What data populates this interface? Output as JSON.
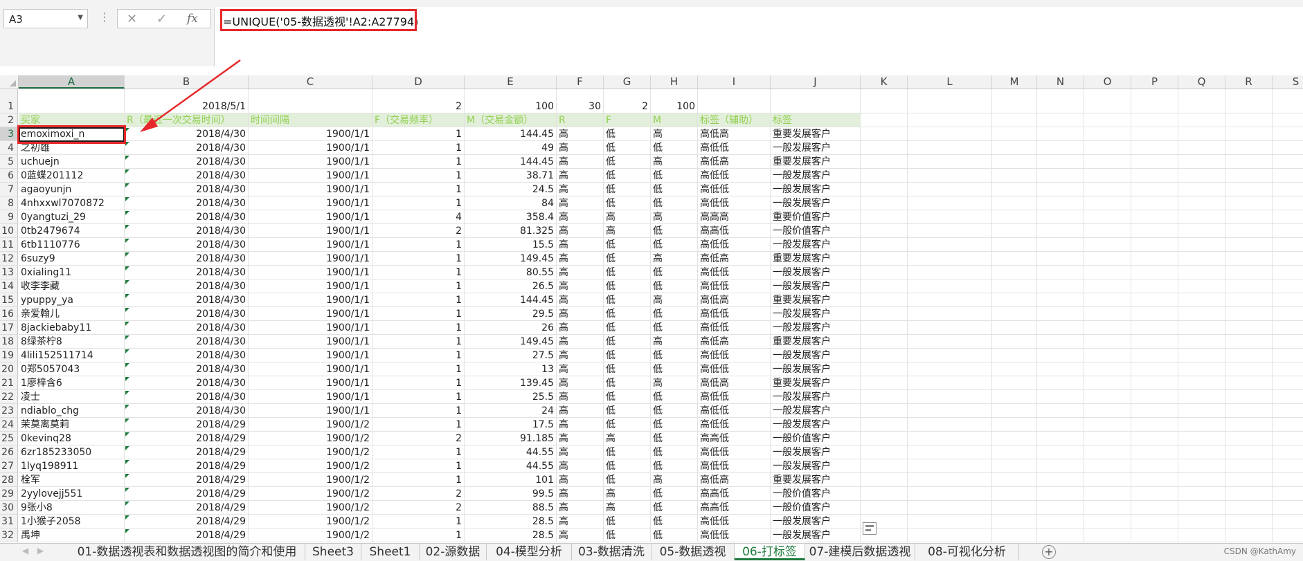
{
  "name_box": {
    "value": "A3",
    "dropdown_icon": "chevron-down-icon"
  },
  "formula_bar": {
    "cancel_icon": "x-icon",
    "confirm_icon": "check-icon",
    "fx_label": "fx",
    "formula": "=UNIQUE('05-数据透视'!A2:A27794)"
  },
  "columns": [
    "A",
    "B",
    "C",
    "D",
    "E",
    "F",
    "G",
    "H",
    "I",
    "J",
    "K",
    "L",
    "M",
    "N",
    "O",
    "P",
    "Q",
    "R",
    "S"
  ],
  "selected_column": "A",
  "selected_row": "3",
  "row1": [
    "",
    "2018/5/1",
    "",
    "2",
    "100",
    "30",
    "2",
    "100",
    "",
    ""
  ],
  "header_row": [
    "买家",
    "R（最近一次交易时间）",
    "时间间隔",
    "F（交易频率）",
    "M（交易金额）",
    "R",
    "F",
    "M",
    "标签（辅助）",
    "标签"
  ],
  "rows": [
    [
      "3",
      "emoximoxi_n",
      "2018/4/30",
      "1900/1/1",
      "1",
      "144.45",
      "高",
      "低",
      "高",
      "高低高",
      "重要发展客户"
    ],
    [
      "4",
      "之初雄",
      "2018/4/30",
      "1900/1/1",
      "1",
      "49",
      "高",
      "低",
      "低",
      "高低低",
      "一般发展客户"
    ],
    [
      "5",
      "uchuejn",
      "2018/4/30",
      "1900/1/1",
      "1",
      "144.45",
      "高",
      "低",
      "高",
      "高低高",
      "重要发展客户"
    ],
    [
      "6",
      "0蓝蝶201112",
      "2018/4/30",
      "1900/1/1",
      "1",
      "38.71",
      "高",
      "低",
      "低",
      "高低低",
      "一般发展客户"
    ],
    [
      "7",
      "agaoyunjn",
      "2018/4/30",
      "1900/1/1",
      "1",
      "24.5",
      "高",
      "低",
      "低",
      "高低低",
      "一般发展客户"
    ],
    [
      "8",
      "4nhxxwl7070872",
      "2018/4/30",
      "1900/1/1",
      "1",
      "84",
      "高",
      "低",
      "低",
      "高低低",
      "一般发展客户"
    ],
    [
      "9",
      "0yangtuzi_29",
      "2018/4/30",
      "1900/1/1",
      "4",
      "358.4",
      "高",
      "高",
      "高",
      "高高高",
      "重要价值客户"
    ],
    [
      "10",
      "0tb2479674",
      "2018/4/30",
      "1900/1/1",
      "2",
      "81.325",
      "高",
      "高",
      "低",
      "高高低",
      "一般价值客户"
    ],
    [
      "11",
      "6tb1110776",
      "2018/4/30",
      "1900/1/1",
      "1",
      "15.5",
      "高",
      "低",
      "低",
      "高低低",
      "一般发展客户"
    ],
    [
      "12",
      "6suzy9",
      "2018/4/30",
      "1900/1/1",
      "1",
      "149.45",
      "高",
      "低",
      "高",
      "高低高",
      "重要发展客户"
    ],
    [
      "13",
      "0xialing11",
      "2018/4/30",
      "1900/1/1",
      "1",
      "80.55",
      "高",
      "低",
      "低",
      "高低低",
      "一般发展客户"
    ],
    [
      "14",
      "收李李藏",
      "2018/4/30",
      "1900/1/1",
      "1",
      "26.5",
      "高",
      "低",
      "低",
      "高低低",
      "一般发展客户"
    ],
    [
      "15",
      "ypuppy_ya",
      "2018/4/30",
      "1900/1/1",
      "1",
      "144.45",
      "高",
      "低",
      "高",
      "高低高",
      "重要发展客户"
    ],
    [
      "16",
      "亲爱翰儿",
      "2018/4/30",
      "1900/1/1",
      "1",
      "29.5",
      "高",
      "低",
      "低",
      "高低低",
      "一般发展客户"
    ],
    [
      "17",
      "8jackiebaby11",
      "2018/4/30",
      "1900/1/1",
      "1",
      "26",
      "高",
      "低",
      "低",
      "高低低",
      "一般发展客户"
    ],
    [
      "18",
      "8绿茶柠8",
      "2018/4/30",
      "1900/1/1",
      "1",
      "149.45",
      "高",
      "低",
      "高",
      "高低高",
      "重要发展客户"
    ],
    [
      "19",
      "4lili152511714",
      "2018/4/30",
      "1900/1/1",
      "1",
      "27.5",
      "高",
      "低",
      "低",
      "高低低",
      "一般发展客户"
    ],
    [
      "20",
      "0郑5057043",
      "2018/4/30",
      "1900/1/1",
      "1",
      "13",
      "高",
      "低",
      "低",
      "高低低",
      "一般发展客户"
    ],
    [
      "21",
      "1廖梓含6",
      "2018/4/30",
      "1900/1/1",
      "1",
      "139.45",
      "高",
      "低",
      "高",
      "高低高",
      "重要发展客户"
    ],
    [
      "22",
      "凌士",
      "2018/4/30",
      "1900/1/1",
      "1",
      "25.5",
      "高",
      "低",
      "低",
      "高低低",
      "一般发展客户"
    ],
    [
      "23",
      "ndiablo_chg",
      "2018/4/30",
      "1900/1/1",
      "1",
      "24",
      "高",
      "低",
      "低",
      "高低低",
      "一般发展客户"
    ],
    [
      "24",
      "茉莫离莫莉",
      "2018/4/29",
      "1900/1/2",
      "1",
      "17.5",
      "高",
      "低",
      "低",
      "高低低",
      "一般发展客户"
    ],
    [
      "25",
      "0kevinq28",
      "2018/4/29",
      "1900/1/2",
      "2",
      "91.185",
      "高",
      "高",
      "低",
      "高高低",
      "一般价值客户"
    ],
    [
      "26",
      "6zr185233050",
      "2018/4/29",
      "1900/1/2",
      "1",
      "44.55",
      "高",
      "低",
      "低",
      "高低低",
      "一般发展客户"
    ],
    [
      "27",
      "1lyq198911",
      "2018/4/29",
      "1900/1/2",
      "1",
      "44.55",
      "高",
      "低",
      "低",
      "高低低",
      "一般发展客户"
    ],
    [
      "28",
      "栓军",
      "2018/4/29",
      "1900/1/2",
      "1",
      "101",
      "高",
      "低",
      "高",
      "高低高",
      "重要发展客户"
    ],
    [
      "29",
      "2yylovejj551",
      "2018/4/29",
      "1900/1/2",
      "2",
      "99.5",
      "高",
      "高",
      "低",
      "高高低",
      "一般价值客户"
    ],
    [
      "30",
      "9张小8",
      "2018/4/29",
      "1900/1/2",
      "2",
      "88.5",
      "高",
      "高",
      "低",
      "高高低",
      "一般价值客户"
    ],
    [
      "31",
      "1小猴子2058",
      "2018/4/29",
      "1900/1/2",
      "1",
      "28.5",
      "高",
      "低",
      "低",
      "高低低",
      "一般发展客户"
    ],
    [
      "32",
      "禹坤",
      "2018/4/29",
      "1900/1/2",
      "1",
      "28.5",
      "高",
      "低",
      "低",
      "高低低",
      "一般发展客户"
    ]
  ],
  "sheet_tabs": [
    "01-数据透视表和数据透视图的简介和使用",
    "Sheet3",
    "Sheet1",
    "02-源数据",
    "04-模型分析",
    "03-数据清洗",
    "05-数据透视",
    "06-打标签",
    "07-建模后数据透视",
    "08-可视化分析"
  ],
  "active_tab": "06-打标签",
  "add_sheet_icon": "plus-circle-icon",
  "watermark": "CSDN @KathAmy",
  "colors": {
    "highlight_red": "#e6282a",
    "header_fill": "#e2efda",
    "header_text": "#92d050",
    "excel_green": "#1e7a3c"
  }
}
